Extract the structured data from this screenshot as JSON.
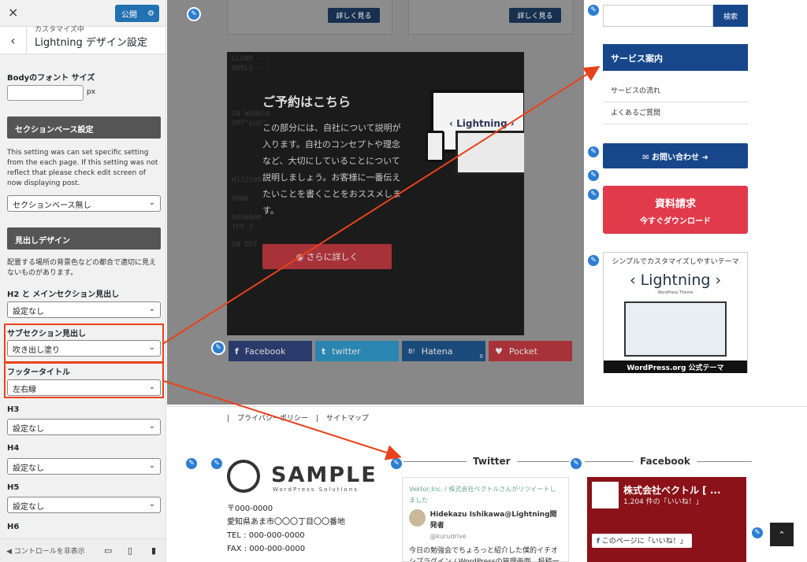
{
  "customizer": {
    "close_icon": "×",
    "publish_label": "公開",
    "gear_icon": "⚙",
    "back_icon": "‹",
    "breadcrumb": "カスタマイズ中",
    "section_title": "Lightning デザイン設定",
    "body_font_label": "Bodyのフォント サイズ",
    "body_font_value": "",
    "body_font_unit": "px",
    "section_base_button": "セクションベース設定",
    "section_base_desc": "This setting was can set specific setting from the each page. If this setting was not reflect that please check edit screen of now displaying post.",
    "section_base_select": "セクションベース無し",
    "heading_button": "見出しデザイン",
    "heading_desc": "配置する場所の背景色などの都合で適切に見えないものがあります。",
    "h2_label": "H2 と メインセクション見出し",
    "h2_value": "設定なし",
    "sub_label": "サブセクション見出し",
    "sub_value": "吹き出し塗り",
    "footer_title_label": "フッタータイトル",
    "footer_title_value": "左右線",
    "h3_label": "H3",
    "h3_value": "設定なし",
    "h4_label": "H4",
    "h4_value": "設定なし",
    "h5_label": "H5",
    "h5_value": "設定なし",
    "h6_label": "H6",
    "hide_controls": "コントロールを非表示",
    "chevron": "⌄"
  },
  "preview": {
    "more_button": "詳しく見る",
    "hero": {
      "code_lines": [
        "LLUNB ---",
        "NURLS ---",
        "IN W4BH16",
        "XMT\"pub\"",
        "W132100",
        "XMNN",
        "9000000",
        "TEP 2",
        "ON DBT"
      ],
      "title": "ご予約はこちら",
      "desc": "この部分には、自社について説明が入ります。自社のコンセプトや理念など、大切にしていることについて説明しましょう。お客様に一番伝えたいことを書くことをおススメします。",
      "cta": "さらに詳しく",
      "brand": "‹ Lightning ›"
    },
    "share": [
      {
        "label": "Facebook",
        "icon": "f",
        "color": "#2a3a6b"
      },
      {
        "label": "twitter",
        "icon": "t",
        "color": "#2a86b0"
      },
      {
        "label": "Hatena",
        "icon": "B!",
        "color": "#1a4a7a",
        "count": "0"
      },
      {
        "label": "Pocket",
        "icon": "♥",
        "color": "#a8323a"
      }
    ],
    "search_button": "検索",
    "service_heading": "サービス案内",
    "service_items": [
      "サービスの流れ",
      "よくあるご質問"
    ],
    "contact_button": "✉ お問い合わせ ➜",
    "docreq_line1": "資料請求",
    "docreq_line2": "今すぐダウンロード",
    "banner_tag": "シンプルでカスタマイズしやすいテーマ",
    "banner_logo": "‹ Lightning ›",
    "banner_sub": "WordPress Theme",
    "banner_foot": "WordPress.org 公式テーマ",
    "footer_links": [
      "プライバシーポリシー",
      "サイトマップ"
    ],
    "sample_word": "SAMPLE",
    "sample_sub": "WordPress Solutions",
    "address": [
      "〒000-0000",
      "愛知県あま市〇〇〇丁目〇〇番地",
      "TEL : 000-000-0000",
      "FAX : 000-000-0000"
    ],
    "twitter_heading": "Twitter",
    "facebook_heading": "Facebook",
    "tweet": {
      "retweet": "Vektor,Inc. / 株式会社ベクトルさんがリツイートしました",
      "author": "Hidekazu Ishikawa@Lightning開発者",
      "handle": "@kurudrive",
      "body": "今日の勉強会でちょろっと紹介した僕的イチオシプラグイン / WordPressの管理画面、投稿一覧にカスタムフィ"
    },
    "fb": {
      "name": "株式会社ベクトル [ ...",
      "likes": "1,204 件の「いいね！」",
      "like_btn": "このページに「いいね！」"
    },
    "totop_icon": "⌃",
    "pencil_icon": "✎"
  },
  "colors": {
    "accent_blue": "#17478a",
    "publish_blue": "#2271b1",
    "doc_red": "#e13a4b",
    "annotation_red": "#e8421c"
  }
}
